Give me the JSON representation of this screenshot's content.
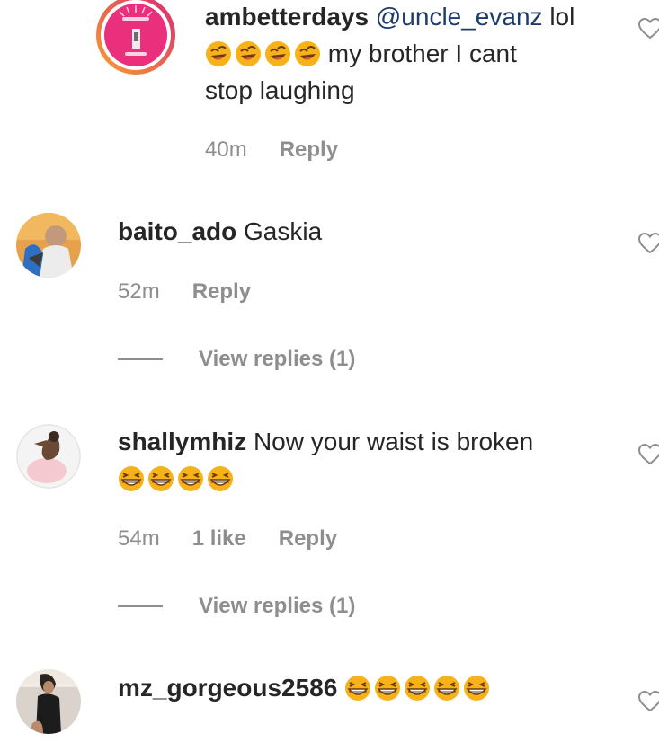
{
  "comments": [
    {
      "username": "ambetterdays",
      "mention": "@uncle_evanz",
      "text_before_emoji": "lol",
      "text_after_emoji": "my brother I cant",
      "text_line3": "stop laughing",
      "emoji": "rolling-on-floor-laughing",
      "emoji_count": 4,
      "time": "40m",
      "reply_label": "Reply"
    },
    {
      "username": "baito_ado",
      "text": "Gaskia",
      "time": "52m",
      "reply_label": "Reply",
      "view_replies": "View replies (1)"
    },
    {
      "username": "shallymhiz",
      "text": "Now your waist is broken",
      "emoji": "grinning-squinting-face",
      "emoji_count": 4,
      "time": "54m",
      "likes": "1 like",
      "reply_label": "Reply",
      "view_replies": "View replies (1)"
    },
    {
      "username": "mz_gorgeous2586",
      "emoji": "grinning-squinting-face",
      "emoji_count": 5
    }
  ],
  "colors": {
    "text": "#262626",
    "secondary": "#8e8e8e",
    "mention": "#1d3b6b",
    "story_ring_start": "#f9a12e",
    "story_ring_end": "#d62976"
  }
}
